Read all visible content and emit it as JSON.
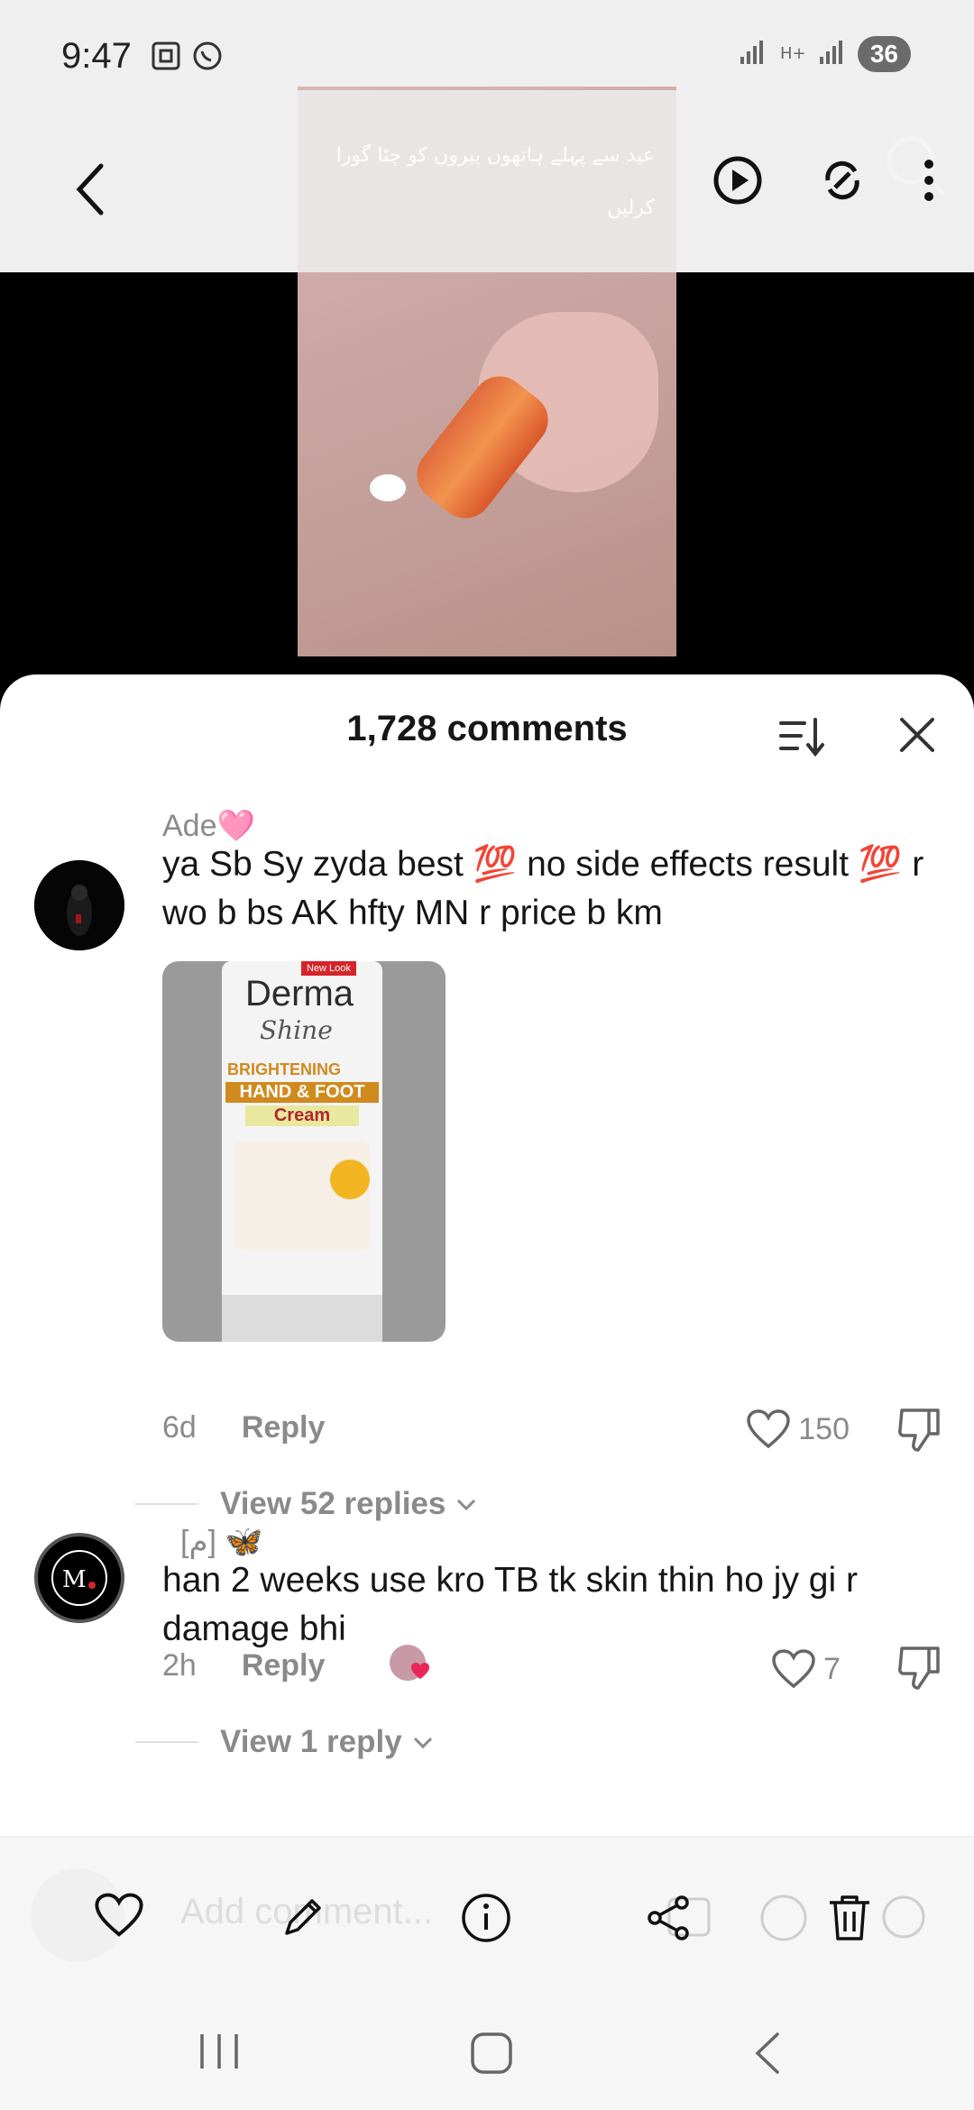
{
  "status_bar": {
    "time": "9:47",
    "battery": "36"
  },
  "video": {
    "caption": "عید سے پہلے ہاتھوں پیروں کو چٹا گورا کرلیں"
  },
  "comments_sheet": {
    "title": "1,728 comments"
  },
  "comments": [
    {
      "username": "Ade🩷",
      "text": "ya Sb Sy zyda best 💯 no side effects result 💯 r wo b bs AK hfty MN r price b km",
      "time": "6d",
      "reply_label": "Reply",
      "likes": "150",
      "view_replies": "View 52 replies",
      "image": {
        "brand": "Derma",
        "script": "Shine",
        "line1": "BRIGHTENING",
        "line2": "HAND & FOOT",
        "line3": "Cream",
        "badge": "New Look"
      }
    },
    {
      "username": "[م] 🦋",
      "text": "han 2 weeks use kro TB tk skin thin ho jy gi r damage bhi",
      "time": "2h",
      "reply_label": "Reply",
      "likes": "7",
      "view_replies": "View 1 reply"
    }
  ],
  "composer": {
    "placeholder": "Add comment..."
  },
  "colors": {
    "text": "#161616",
    "muted": "#8a8a8a",
    "sheet": "#ffffff",
    "bar": "#efefef"
  }
}
